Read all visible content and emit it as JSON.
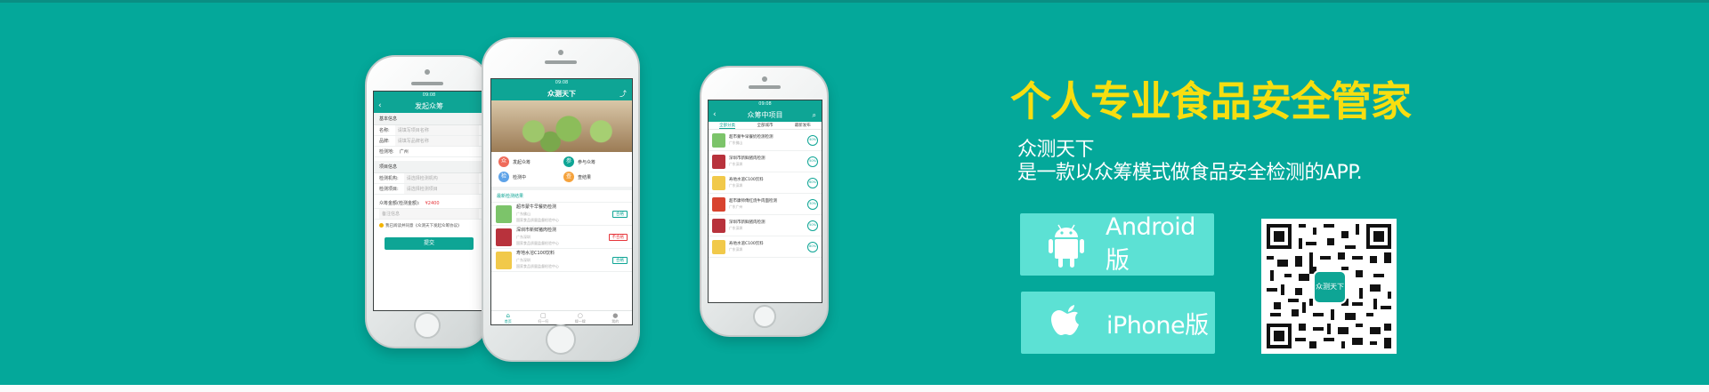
{
  "hero": {
    "headline": "个人专业食品安全管家",
    "line1": "众测天下",
    "line2": "是一款以众筹模式做食品安全检测的APP.",
    "android_label": "Android版",
    "iphone_label": "iPhone版",
    "qr_logo_text": "众测天下"
  },
  "phone1": {
    "status": "09:08",
    "title": "发起众筹",
    "section1": "基本信息",
    "rows": [
      {
        "label": "名称:",
        "placeholder": "请填写项目名称"
      },
      {
        "label": "品牌:",
        "placeholder": "请填写品牌名称"
      },
      {
        "label": "检测地:",
        "value": "广州"
      }
    ],
    "section2": "项目信息",
    "rows2": [
      {
        "label": "检测机构:",
        "placeholder": "请选择检测机构"
      },
      {
        "label": "检测项目:",
        "placeholder": "请选择检测项目"
      }
    ],
    "amount_label": "众筹金额(检测金额):",
    "amount_value": "¥2400",
    "remark": "备注信息",
    "agree": "我已阅读并同意《众测天下发起众筹协议》",
    "submit": "提交"
  },
  "phone2": {
    "status": "09:08",
    "logo": "众测天下",
    "share_icon": "share-icon",
    "grid": [
      {
        "label": "发起众筹",
        "color": "#ef6b5a",
        "glyph": "众"
      },
      {
        "label": "参与众筹",
        "color": "#0ea595",
        "glyph": "参"
      },
      {
        "label": "检测中",
        "color": "#5ea3e8",
        "glyph": "检"
      },
      {
        "label": "查结果",
        "color": "#f5a23c",
        "glyph": "查"
      }
    ],
    "section": "最新检测结果",
    "items": [
      {
        "title": "超市蒙牛早餐奶检测",
        "sub": "广东佛山",
        "sub2": "国家食品质量监督检验中心",
        "tag": "合格",
        "tag_color": "#0ea595",
        "thumb": "#7cc46a"
      },
      {
        "title": "深圳市新鲜猪肉检测",
        "sub": "广东深圳",
        "sub2": "国家食品质量监督检验中心",
        "tag": "不合格",
        "tag_color": "#e6353a",
        "thumb": "#b8323c"
      },
      {
        "title": "寿地水溶C100饮料",
        "sub": "广东深圳",
        "sub2": "国家食品质量监督检验中心",
        "tag": "合格",
        "tag_color": "#0ea595",
        "thumb": "#f1c94a"
      }
    ],
    "tabs": [
      {
        "label": "首页",
        "glyph": "⌂",
        "active": true
      },
      {
        "label": "扫一扫",
        "glyph": "▢"
      },
      {
        "label": "搜一搜",
        "glyph": "○"
      },
      {
        "label": "我的",
        "glyph": "●"
      }
    ]
  },
  "phone3": {
    "status": "09:08",
    "title": "众筹中项目",
    "filters": [
      "全部分类",
      "全部城市",
      "最新发布"
    ],
    "items": [
      {
        "title": "超市蒙牛早餐奶检测检测",
        "sub": "广东佛山",
        "pct": "40%",
        "thumb": "#7cc46a"
      },
      {
        "title": "深圳市新鲜猪肉检测",
        "sub": "广东深圳",
        "pct": "50%",
        "thumb": "#b8323c"
      },
      {
        "title": "寿地水溶C100饮料",
        "sub": "广东深圳",
        "pct": "60%",
        "thumb": "#f1c94a"
      },
      {
        "title": "超市康师傅红烧牛肉面检测",
        "sub": "广东广州",
        "pct": "30%",
        "thumb": "#d8432f"
      },
      {
        "title": "深圳市新鲜猪肉检测",
        "sub": "广东深圳",
        "pct": "50%",
        "thumb": "#b8323c"
      },
      {
        "title": "寿地水溶C100饮料",
        "sub": "广东深圳",
        "pct": "80%",
        "thumb": "#f1c94a"
      }
    ]
  },
  "colors": {
    "background": "#04a89a",
    "headline": "#f7de10",
    "button": "#5ce1d4",
    "accent": "#0ea595"
  }
}
